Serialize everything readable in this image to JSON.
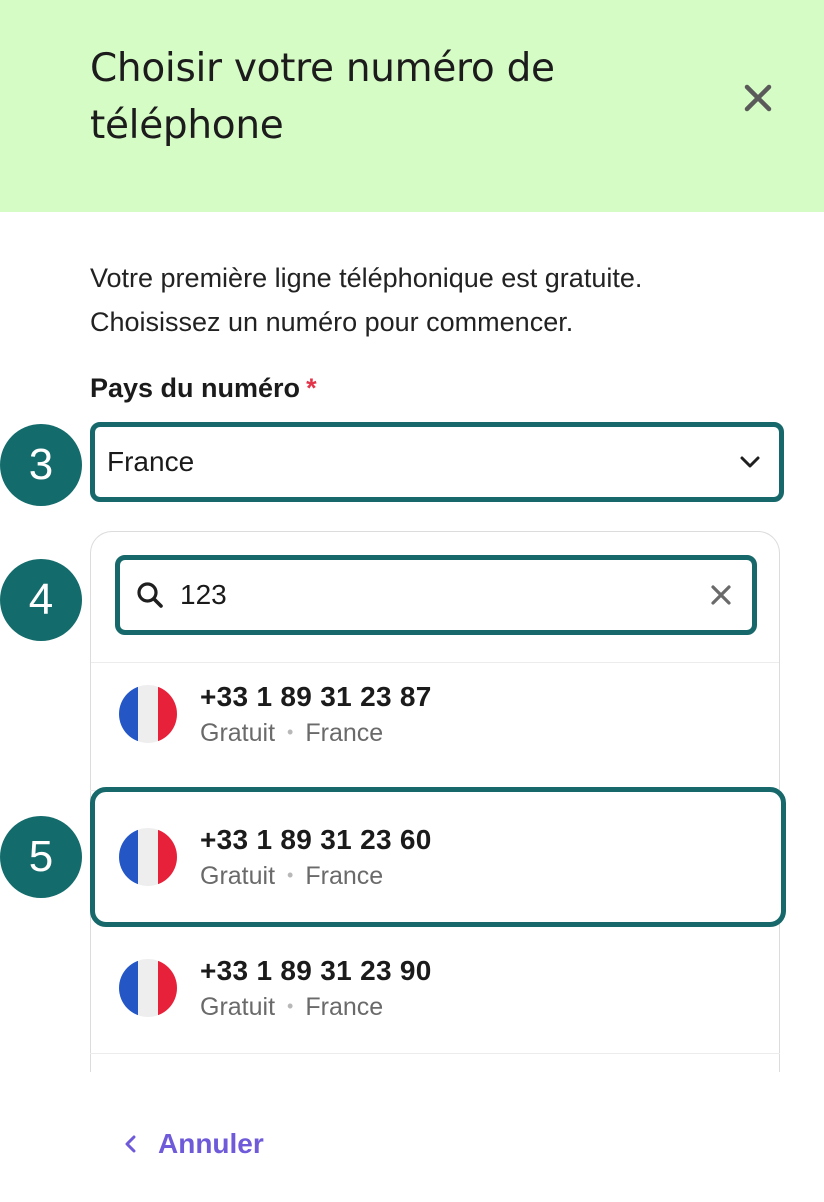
{
  "dialog": {
    "title": "Choisir votre numéro de téléphone",
    "intro": "Votre première ligne téléphonique est gratuite. Choisissez un numéro pour commencer."
  },
  "country_field": {
    "label": "Pays du numéro",
    "required_mark": "*",
    "value": "France"
  },
  "search": {
    "value": "123"
  },
  "numbers": [
    {
      "number": "+33 1 89 31 23 87",
      "price": "Gratuit",
      "country": "France"
    },
    {
      "number": "+33 1 89 31 23 60",
      "price": "Gratuit",
      "country": "France"
    },
    {
      "number": "+33 1 89 31 23 90",
      "price": "Gratuit",
      "country": "France"
    }
  ],
  "meta_separator": "•",
  "step_badges": [
    "3",
    "4",
    "5"
  ],
  "cancel_label": "Annuler",
  "colors": {
    "header_bg": "#d6fcc6",
    "highlight": "#17686a",
    "badge": "#146b6b",
    "link": "#6f5bd9",
    "required": "#e3344a",
    "flag_blue": "#2457c5",
    "flag_white": "#eeeeee",
    "flag_red": "#e8213a"
  },
  "icons": {
    "close": "close-icon",
    "dropdown": "chevron-down-icon",
    "search": "search-icon",
    "clear": "clear-icon",
    "flag": "france-flag-icon",
    "back": "chevron-left-icon"
  }
}
